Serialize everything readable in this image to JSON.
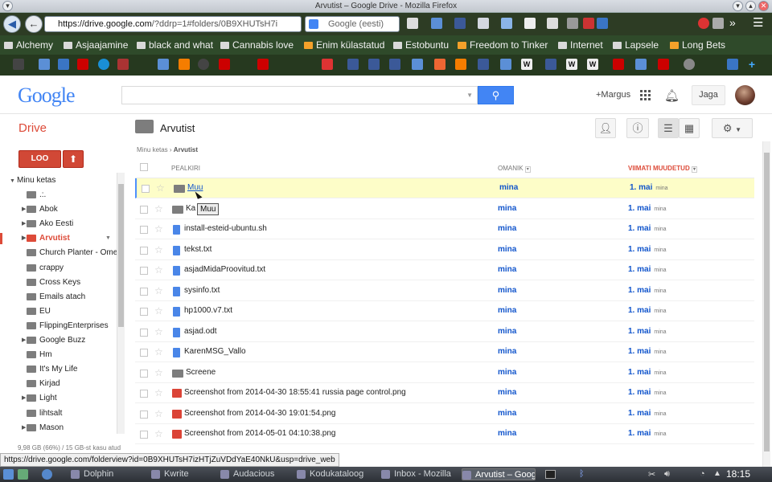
{
  "window": {
    "title": "Arvutist – Google Drive - Mozilla Firefox"
  },
  "browser": {
    "url_domain": "https://drive.google.com",
    "url_path": "/?ddrp=1#folders/0B9XHUTsH7i",
    "search_placeholder": "Google (eesti)",
    "bookmarks": [
      "Alchemy",
      "Asjaajamine",
      "black and what",
      "Cannabis love",
      "Enim külastatud",
      "Estobuntu",
      "Freedom to Tinker",
      "Internet",
      "Lapsele",
      "Long Bets"
    ],
    "status_url": "https://drive.google.com/folderview?id=0B9XHUTsH7izHTjZuVDdYaE40NkU&usp=drive_web"
  },
  "google_header": {
    "logo": "Google",
    "user_link": "+Margus",
    "share_button": "Jaga"
  },
  "drive": {
    "app_title": "Drive",
    "create_button": "LOO",
    "current_folder": "Arvutist",
    "breadcrumb_root": "Minu ketas",
    "breadcrumb_current": "Arvutist",
    "quota": "9,98 GB (66%) / 15 GB-st kasu atud",
    "tree_root": "Minu ketas",
    "tree": [
      {
        "label": ".:.",
        "expandable": false
      },
      {
        "label": "Abok",
        "expandable": true
      },
      {
        "label": "Ako Eesti",
        "expandable": true
      },
      {
        "label": "Arvutist",
        "expandable": true,
        "selected": true
      },
      {
        "label": "Church Planter - Ome",
        "expandable": false
      },
      {
        "label": "crappy",
        "expandable": false
      },
      {
        "label": "Cross Keys",
        "expandable": false
      },
      {
        "label": "Emails atach",
        "expandable": false
      },
      {
        "label": "EU",
        "expandable": false
      },
      {
        "label": "FlippingEnterprises",
        "expandable": false
      },
      {
        "label": "Google Buzz",
        "expandable": true
      },
      {
        "label": "Hm",
        "expandable": false
      },
      {
        "label": "It's My Life",
        "expandable": false
      },
      {
        "label": "Kirjad",
        "expandable": false
      },
      {
        "label": "Light",
        "expandable": true
      },
      {
        "label": "lihtsalt",
        "expandable": false
      },
      {
        "label": "Mason",
        "expandable": true
      }
    ],
    "columns": {
      "title": "PEALKIRI",
      "owner": "OMANIK",
      "modified": "VIIMATI MUUDETUD"
    },
    "files": [
      {
        "name": "Muu",
        "type": "folder",
        "owner": "mina",
        "date": "1. mai",
        "by": "mina"
      },
      {
        "name": "Ka",
        "type": "folder",
        "owner": "mina",
        "date": "1. mai",
        "by": "mina"
      },
      {
        "name": "install-esteid-ubuntu.sh",
        "type": "doc",
        "owner": "mina",
        "date": "1. mai",
        "by": "mina"
      },
      {
        "name": "tekst.txt",
        "type": "doc",
        "owner": "mina",
        "date": "1. mai",
        "by": "mina"
      },
      {
        "name": "asjadMidaProovitud.txt",
        "type": "doc",
        "owner": "mina",
        "date": "1. mai",
        "by": "mina"
      },
      {
        "name": "sysinfo.txt",
        "type": "doc",
        "owner": "mina",
        "date": "1. mai",
        "by": "mina"
      },
      {
        "name": "hp1000.v7.txt",
        "type": "doc",
        "owner": "mina",
        "date": "1. mai",
        "by": "mina"
      },
      {
        "name": "asjad.odt",
        "type": "doc",
        "owner": "mina",
        "date": "1. mai",
        "by": "mina"
      },
      {
        "name": "KarenMSG_Vallo",
        "type": "doc",
        "owner": "mina",
        "date": "1. mai",
        "by": "mina"
      },
      {
        "name": "Screene",
        "type": "folder",
        "owner": "mina",
        "date": "1. mai",
        "by": "mina"
      },
      {
        "name": "Screenshot from 2014-04-30 18:55:41 russia page control.png",
        "type": "img",
        "owner": "mina",
        "date": "1. mai",
        "by": "mina"
      },
      {
        "name": "Screenshot from 2014-04-30 19:01:54.png",
        "type": "img",
        "owner": "mina",
        "date": "1. mai",
        "by": "mina"
      },
      {
        "name": "Screenshot from 2014-05-01 04:10:38.png",
        "type": "img",
        "owner": "mina",
        "date": "1. mai",
        "by": "mina"
      }
    ],
    "tooltip": "Muu"
  },
  "taskbar": {
    "tasks": [
      "Dolphin",
      "Kwrite",
      "Audacious",
      "Kodukataloog",
      "Inbox - Mozilla",
      "Arvutist – Goog"
    ],
    "active_task": 5,
    "clock": "18:15"
  },
  "colors": {
    "drive_red": "#dd4b39",
    "google_blue": "#4285f4",
    "link_blue": "#1155cc",
    "highlight": "#fdfdc8"
  }
}
